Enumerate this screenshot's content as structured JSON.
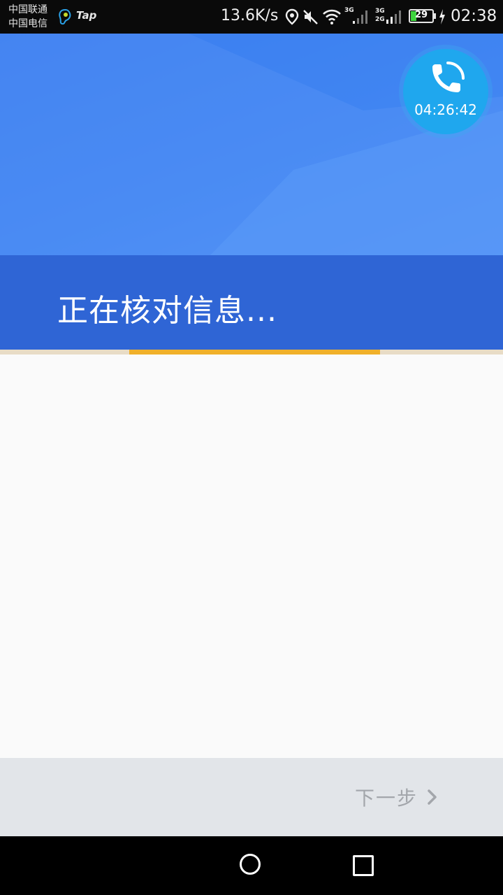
{
  "status_bar": {
    "carrier_1": "中国联通",
    "carrier_2": "中国电信",
    "tap_app_label": "Tap",
    "net_speed": "13.6K/s",
    "network_1": "3G",
    "network_2": "3G",
    "network_3": "2G",
    "battery_level": "29",
    "time": "02:38"
  },
  "header": {
    "title": "正在核对信息..."
  },
  "call_bubble": {
    "timer": "04:26:42"
  },
  "footer": {
    "next_label": "下一步"
  },
  "colors": {
    "header_blue": "#3d7ff0",
    "band_blue": "#2f65d5",
    "progress_accent": "#f0b02a",
    "call_bubble": "#1fa7ee"
  }
}
